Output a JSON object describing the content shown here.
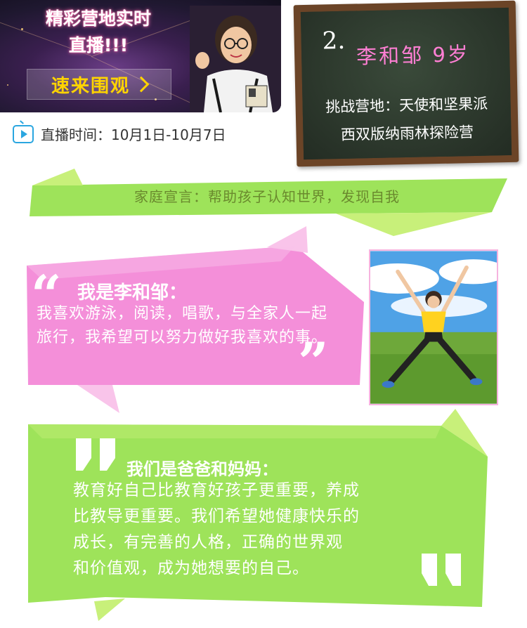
{
  "live": {
    "title_line1": "精彩营地实时",
    "title_line2": "直播!!!",
    "watch_label": "速来围观",
    "time_label": "直播时间：10月1日-10月7日"
  },
  "chalkboard": {
    "number": "2.",
    "name": "李和邹  9岁",
    "camp_line1": "挑战营地：天使和坚果派",
    "camp_line2": "西双版纳雨林探险营"
  },
  "declaration": {
    "text": "家庭宣言：帮助孩子认知世界，发现自我"
  },
  "child_quote": {
    "heading": "我是李和邹：",
    "body": "我喜欢游泳，阅读，唱歌，与全家人一起旅行，我希望可以努力做好我喜欢的事。"
  },
  "parent_quote": {
    "heading": "我们是爸爸和妈妈：",
    "line1": "教育好自己比教育好孩子更重要，养成",
    "line2": "比教导更重要。我们希望她健康快乐的",
    "line3": "成长，有完善的人格，正确的世界观",
    "line4": "和价值观，成为她想要的自己。"
  },
  "colors": {
    "green": "#9ee35a",
    "green_dark": "#6ec23a",
    "pink": "#f48fd9",
    "pink_light": "#f9c4ea",
    "yellow": "#ffd400",
    "tv_blue": "#2aa6e0"
  }
}
